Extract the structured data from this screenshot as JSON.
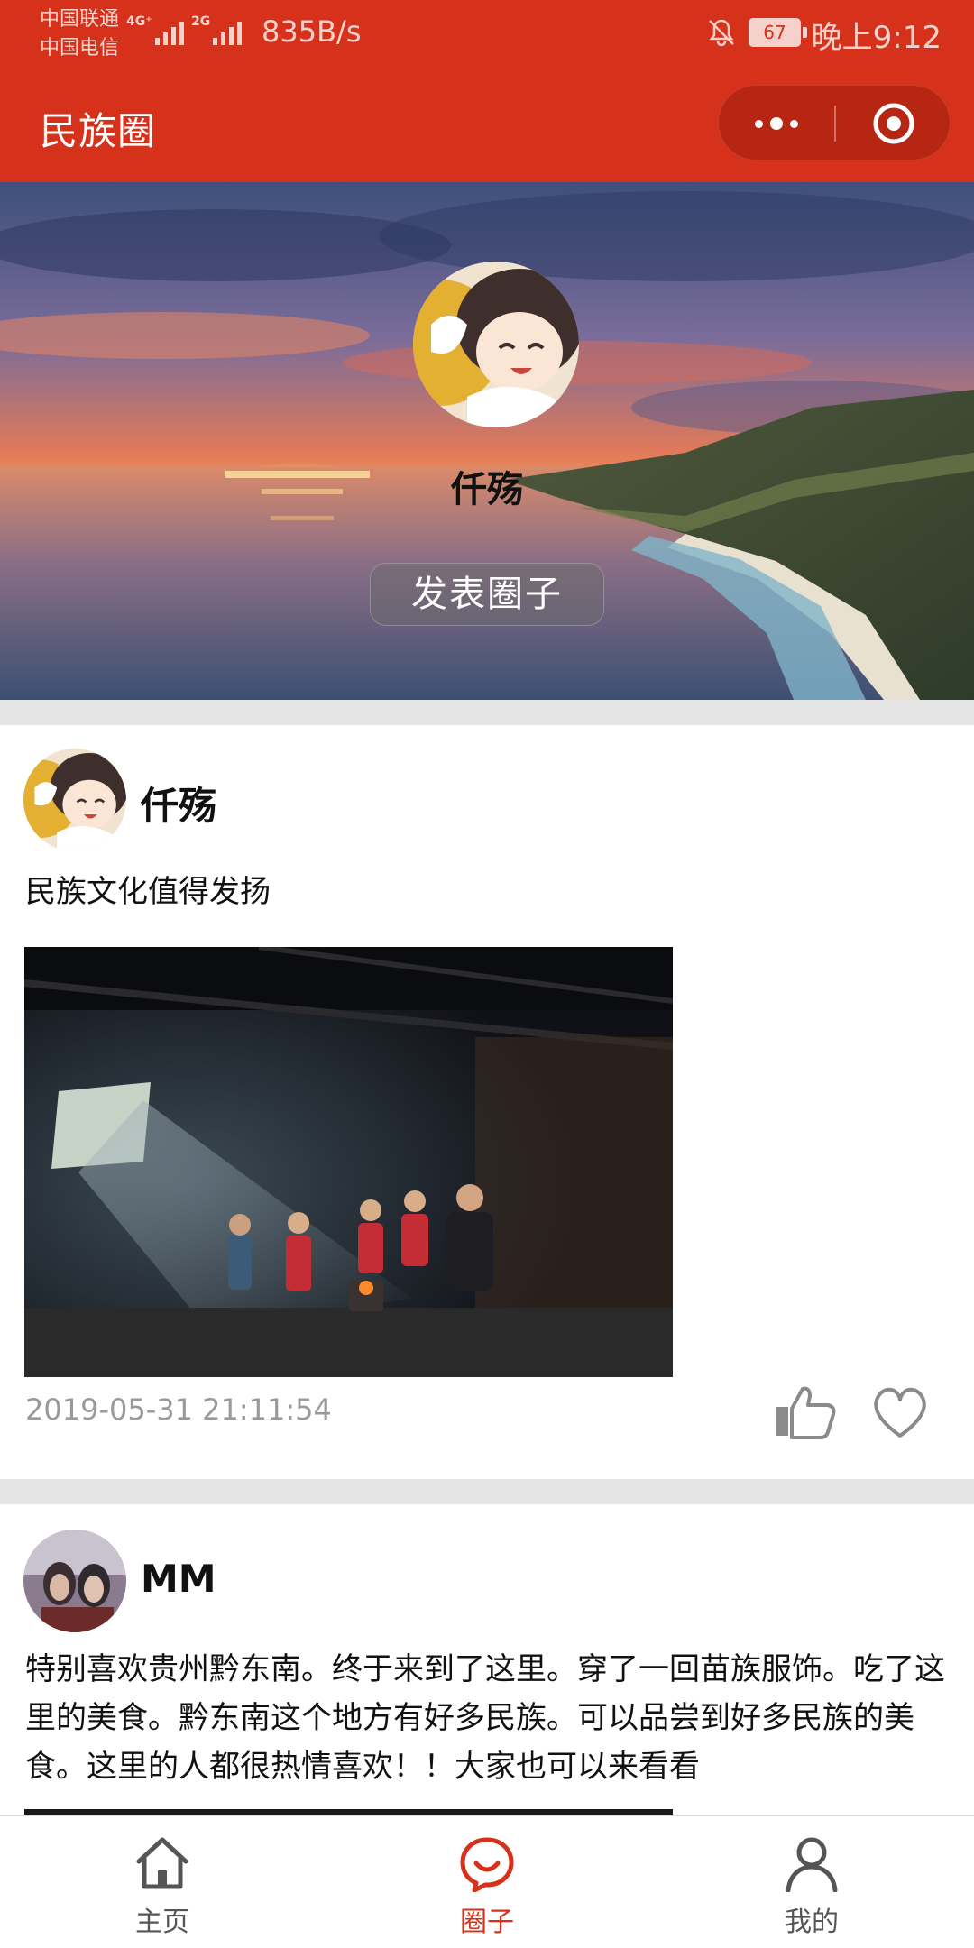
{
  "status_bar": {
    "carrier_1": "中国联通",
    "carrier_2": "中国电信",
    "net_1": "4G⁺",
    "net_2": "2G",
    "speed": "835B/s",
    "battery": "67",
    "time": "晚上9:12",
    "icons": [
      "signal-icon",
      "bell-muted-icon",
      "battery-icon"
    ]
  },
  "header": {
    "title": "民族圈",
    "more_icon": "more-dots-icon",
    "close_icon": "target-close-icon"
  },
  "banner": {
    "user_name": "仟殇",
    "post_button": "发表圈子"
  },
  "posts": [
    {
      "author": "仟殇",
      "content": "民族文化值得发扬",
      "timestamp": "2019-05-31 21:11:54",
      "has_photo": true
    },
    {
      "author": "MM",
      "content": "特别喜欢贵州黔东南。终于来到了这里。穿了一回苗族服饰。吃了这里的美食。黔东南这个地方有好多民族。可以品尝到好多民族的美食。这里的人都很热情喜欢！！大家也可以来看看",
      "has_photo": true
    }
  ],
  "tabbar": {
    "items": [
      {
        "label": "主页",
        "icon": "home-icon"
      },
      {
        "label": "圈子",
        "icon": "chat-circle-icon"
      },
      {
        "label": "我的",
        "icon": "person-icon"
      }
    ],
    "active_index": 1,
    "active_color": "#d6311b"
  },
  "colors": {
    "brand_red": "#d6311b",
    "divider_gray": "#e4e4e4",
    "timestamp_gray": "#9a9a9a"
  }
}
